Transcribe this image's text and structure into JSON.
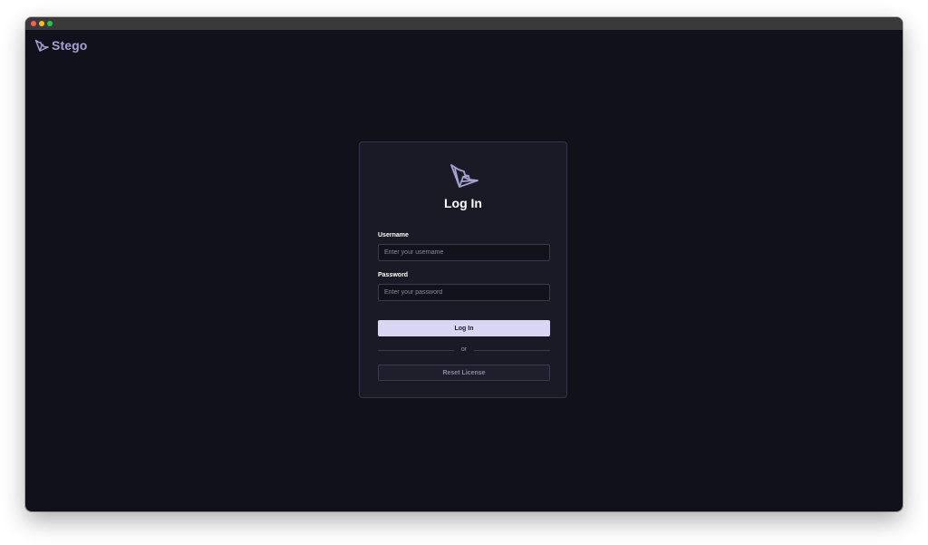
{
  "window": {
    "controls": [
      "close-button",
      "minimize-button",
      "maximize-button"
    ],
    "colors": {
      "close": "#ff5f57",
      "minimize": "#febc2e",
      "maximize": "#28c840"
    }
  },
  "brand": {
    "name": "Stego",
    "icon": "stego-logo-icon",
    "color": "#a4a2d0"
  },
  "login": {
    "title": "Log In",
    "icon": "stego-logo-icon",
    "username": {
      "label": "Username",
      "placeholder": "Enter your username",
      "value": ""
    },
    "password": {
      "label": "Password",
      "placeholder": "Enter your password",
      "value": ""
    },
    "submit_label": "Log In",
    "divider_text": "or",
    "reset_label": "Reset License"
  },
  "colors": {
    "background": "#11111c",
    "card": "#1a1a26",
    "accent": "#d8d6f2"
  }
}
